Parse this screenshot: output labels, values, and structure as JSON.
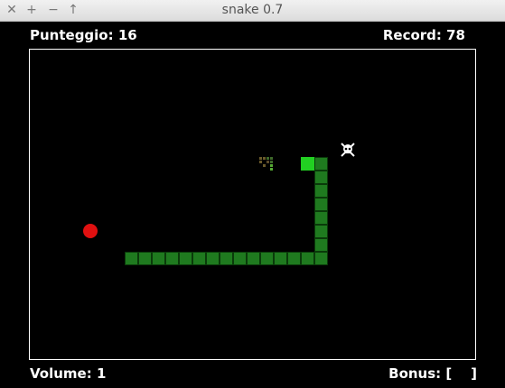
{
  "window": {
    "title": "snake 0.7",
    "buttons": [
      "close",
      "maximize",
      "minimize",
      "up"
    ]
  },
  "hud": {
    "score_label": "Punteggio: 16",
    "record_label": "Record: 78",
    "volume_label": "Volume: 1",
    "bonus_label": "Bonus: [    ]"
  },
  "colors": {
    "snake_body": "#1f7a1f",
    "snake_head": "#22d022",
    "food": "#e01010",
    "arena_border": "#ffffff",
    "background": "#000000"
  },
  "icons": {
    "close": "close-icon",
    "maximize": "plus-icon",
    "minimize": "minus-icon",
    "up": "arrow-up-icon",
    "hazard": "skull-crossbones-icon",
    "bonus": "bonus-pickup-icon"
  }
}
